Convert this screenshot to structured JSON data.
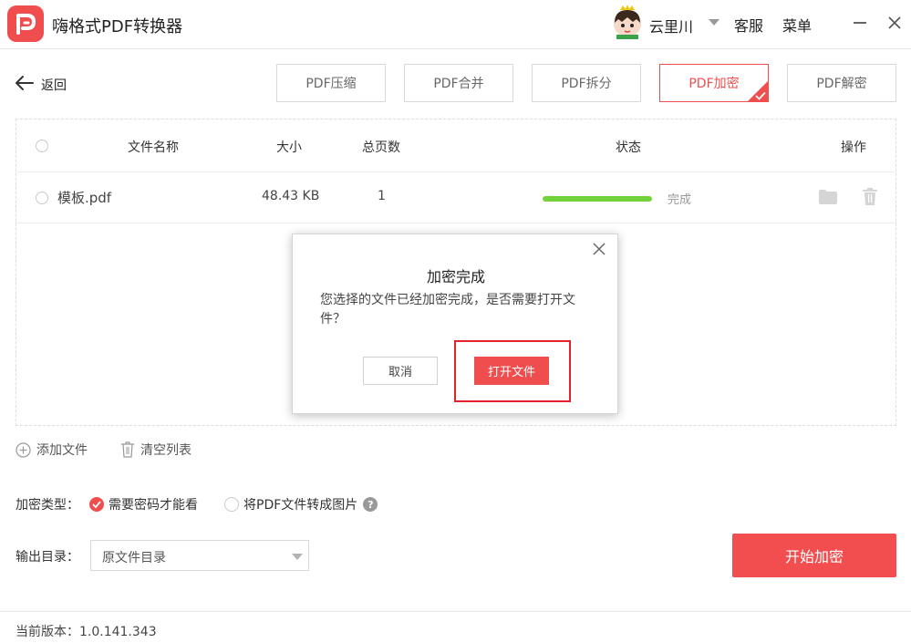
{
  "app": {
    "title": "嗨格式PDF转换器"
  },
  "user": {
    "name": "云里川"
  },
  "header": {
    "service_label": "客服",
    "menu_label": "菜单"
  },
  "toolbar": {
    "back_label": "返回",
    "tabs": [
      {
        "label": "PDF压缩",
        "active": false
      },
      {
        "label": "PDF合并",
        "active": false
      },
      {
        "label": "PDF拆分",
        "active": false
      },
      {
        "label": "PDF加密",
        "active": true
      },
      {
        "label": "PDF解密",
        "active": false
      }
    ]
  },
  "file_list": {
    "columns": {
      "name": "文件名称",
      "size": "大小",
      "pages": "总页数",
      "status": "状态",
      "actions": "操作"
    },
    "rows": [
      {
        "name": "模板.pdf",
        "size": "48.43 KB",
        "pages": "1",
        "status": "完成",
        "progress": 1.0
      }
    ]
  },
  "list_actions": {
    "add_label": "添加文件",
    "clear_label": "清空列表"
  },
  "options": {
    "enc_type_label": "加密类型：",
    "opt_password_label": "需要密码才能看",
    "opt_image_label": "将PDF文件转成图片",
    "help_glyph": "?",
    "output_label": "输出目录：",
    "output_value": "原文件目录",
    "start_label": "开始加密"
  },
  "footer": {
    "version": "当前版本：1.0.141.343"
  },
  "dialog": {
    "title": "加密完成",
    "message": "您选择的文件已经加密完成，是否需要打开文件？",
    "cancel_label": "取消",
    "open_label": "打开文件"
  },
  "colors": {
    "accent": "#f04e4e",
    "progress": "#71d23a",
    "highlight": "#e3222a"
  }
}
